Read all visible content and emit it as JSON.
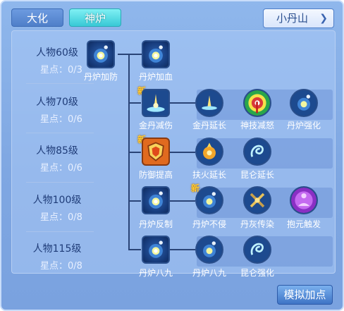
{
  "tabs": [
    {
      "label": "大化",
      "active": false
    },
    {
      "label": "神炉",
      "active": true
    }
  ],
  "dropdown": {
    "selected": "小丹山"
  },
  "levels": [
    {
      "title": "人物60级",
      "stars": "星点：0/3"
    },
    {
      "title": "人物70级",
      "stars": "星点：0/6"
    },
    {
      "title": "人物85级",
      "stars": "星点：0/6"
    },
    {
      "title": "人物100级",
      "stars": "星点：0/8"
    },
    {
      "title": "人物115级",
      "stars": "星点：0/8"
    }
  ],
  "skills": {
    "r0a": {
      "label": "丹炉加防",
      "icon": "furnace-icon"
    },
    "r0b": {
      "label": "丹炉加血",
      "icon": "furnace-icon"
    },
    "r1a": {
      "label": "金丹减伤",
      "icon": "golden-light-icon",
      "new": "新"
    },
    "r1b": {
      "label": "金丹延长",
      "icon": "golden-light-icon"
    },
    "r1c": {
      "label": "神技减怒",
      "icon": "target-icon"
    },
    "r1d": {
      "label": "丹炉强化",
      "icon": "furnace-icon"
    },
    "r2a": {
      "label": "防御提高",
      "icon": "shield-icon",
      "new": "新"
    },
    "r2b": {
      "label": "扶火延长",
      "icon": "fire-wheel-icon"
    },
    "r2c": {
      "label": "昆仑延长",
      "icon": "swirl-icon"
    },
    "r3a": {
      "label": "丹炉反制",
      "icon": "furnace-icon"
    },
    "r3b": {
      "label": "丹炉不侵",
      "icon": "furnace-icon",
      "new": "新"
    },
    "r3c": {
      "label": "丹灰传染",
      "icon": "crossed-axes-icon"
    },
    "r3d": {
      "label": "抱元触发",
      "icon": "meditation-icon"
    },
    "r4a": {
      "label": "丹炉八九",
      "icon": "furnace-icon"
    },
    "r4b": {
      "label": "丹炉八九",
      "icon": "furnace-icon"
    },
    "r4c": {
      "label": "昆仑强化",
      "icon": "swirl-icon"
    }
  },
  "simulate_button": "模拟加点",
  "colors": {
    "panel": "#8fb7ec",
    "active_tab": "#38c9d6",
    "new_tag": "#ffcc33"
  }
}
